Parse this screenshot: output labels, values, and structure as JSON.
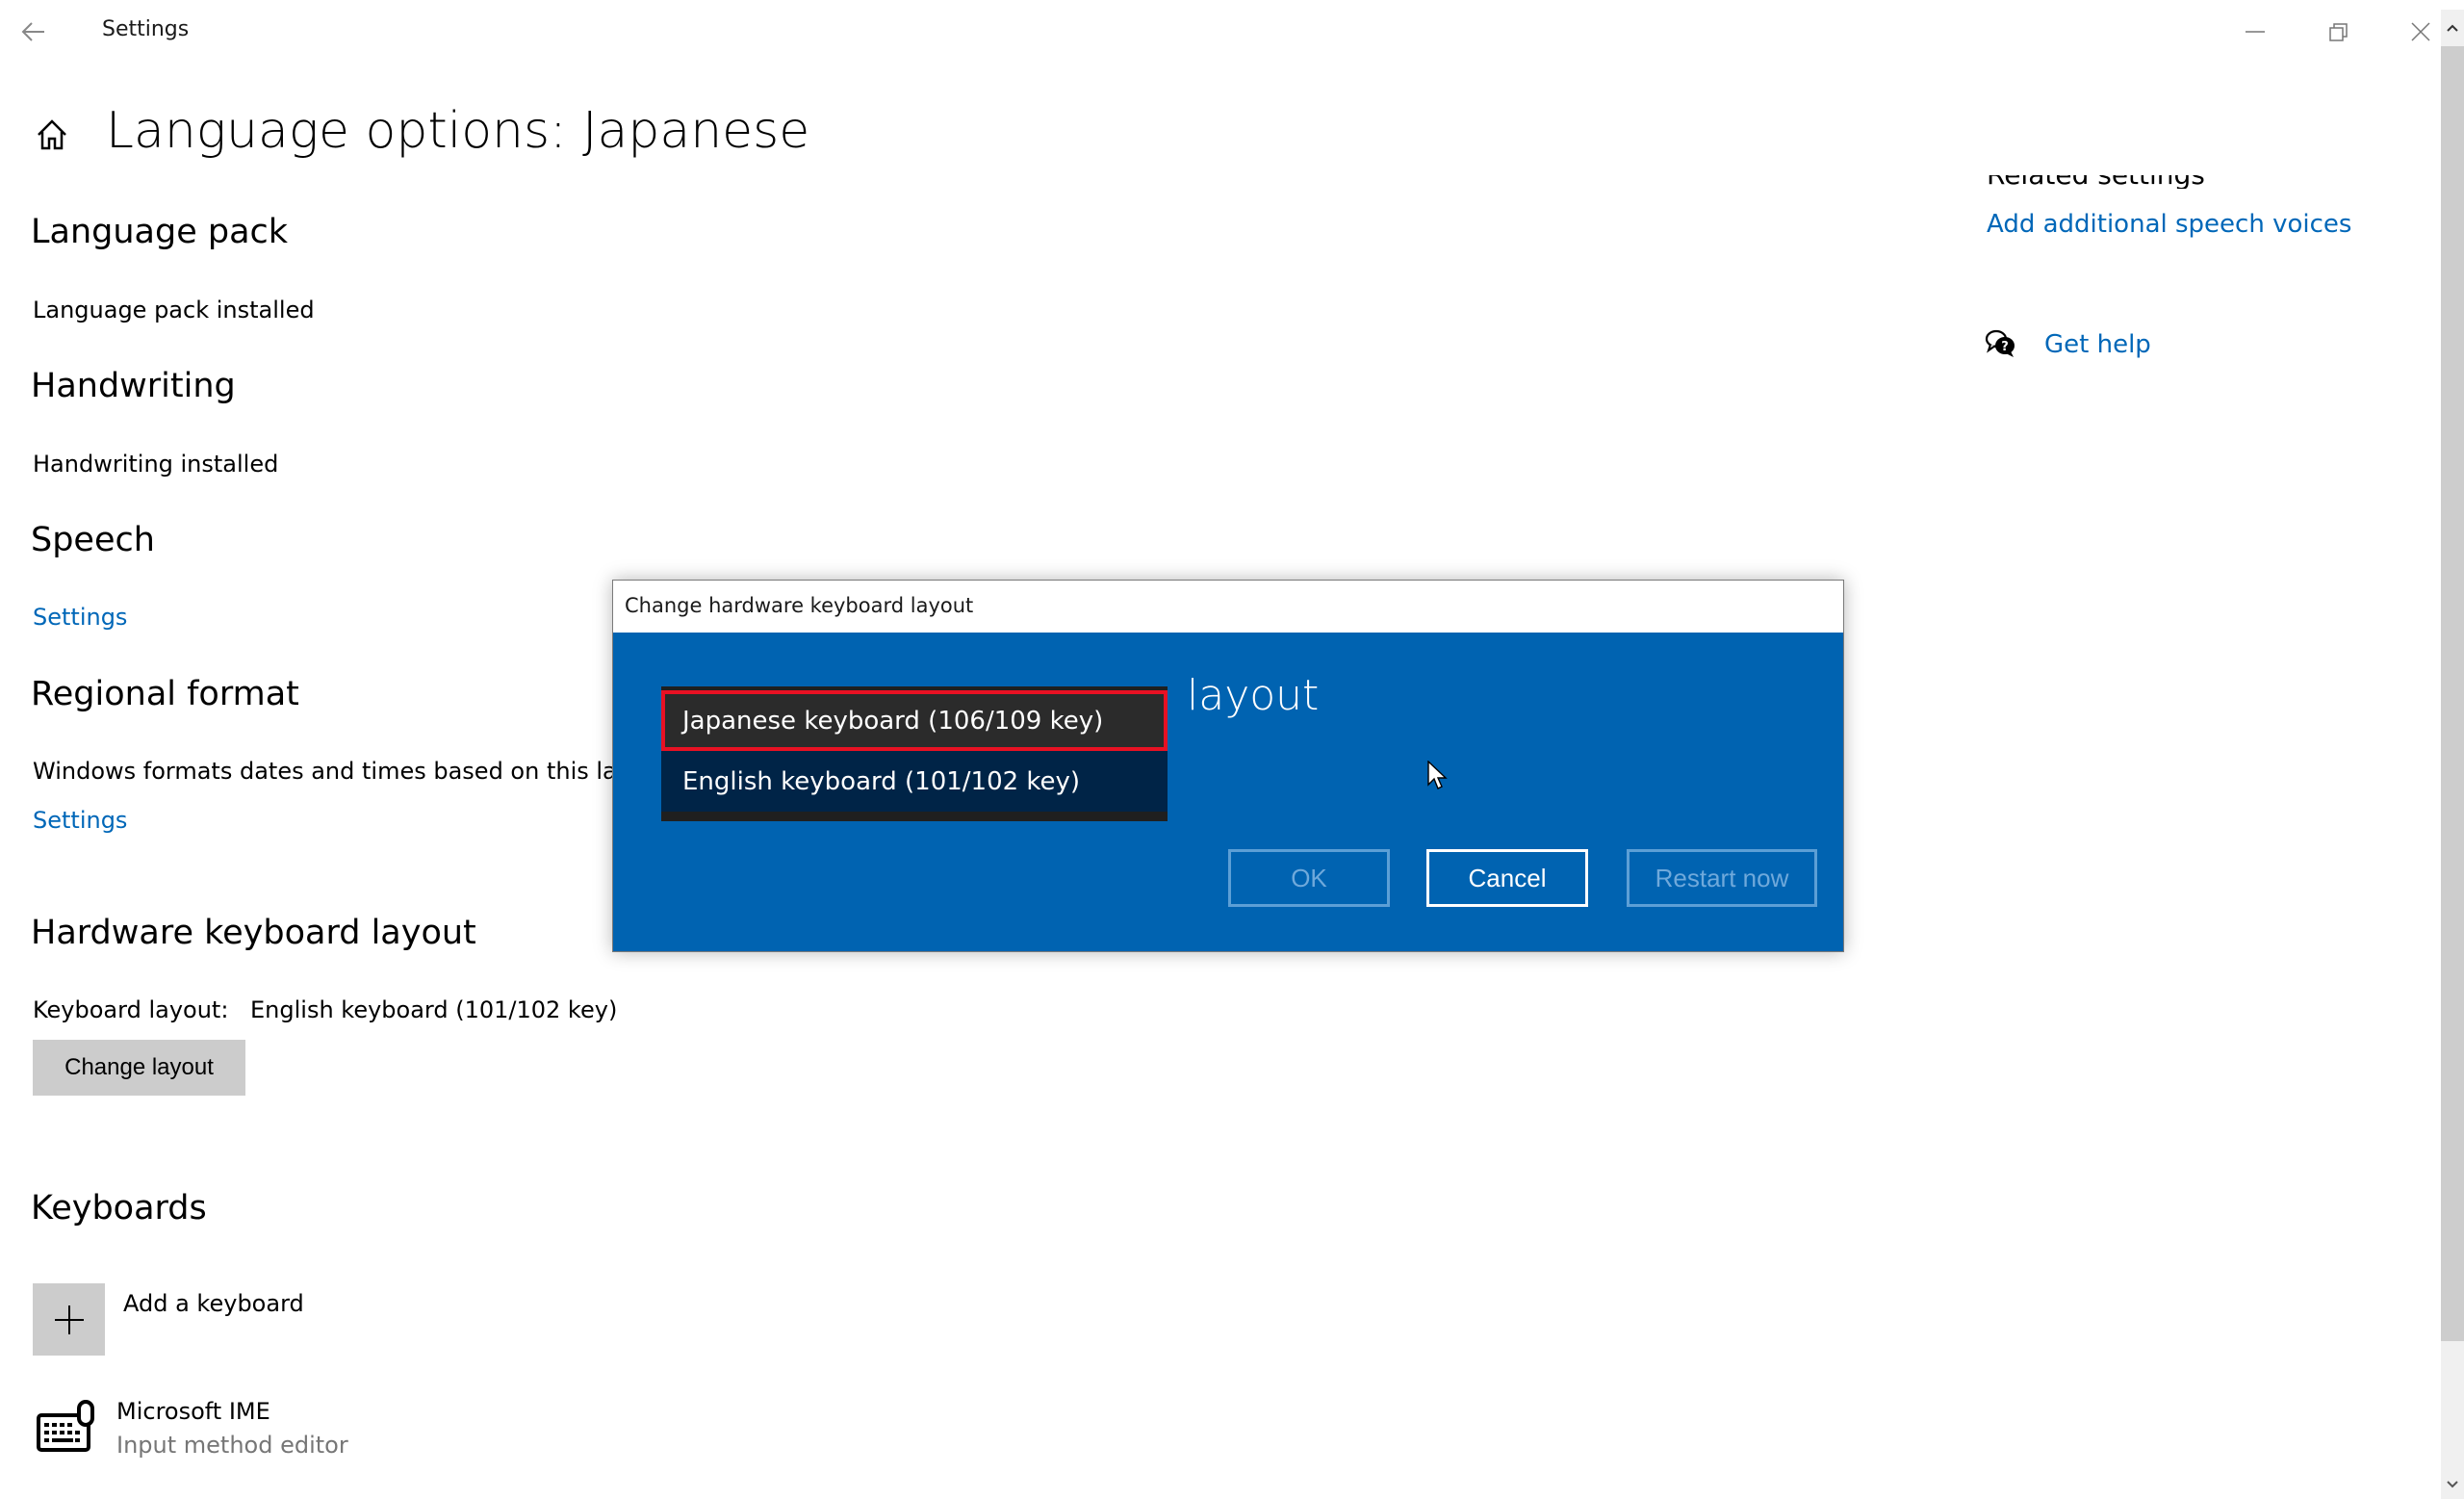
{
  "window": {
    "app_title": "Settings",
    "icons": {
      "back": "back-arrow-icon",
      "minimize": "minimize-icon",
      "maximize": "restore-icon",
      "close": "close-icon"
    }
  },
  "page": {
    "title": "Language options: Japanese",
    "home_icon": "home-icon"
  },
  "sections": {
    "language_pack": {
      "heading": "Language pack",
      "status": "Language pack installed"
    },
    "handwriting": {
      "heading": "Handwriting",
      "status": "Handwriting installed"
    },
    "speech": {
      "heading": "Speech",
      "link": "Settings"
    },
    "regional_format": {
      "heading": "Regional format",
      "description": "Windows formats dates and times based on this lan",
      "link": "Settings"
    },
    "hardware_keyboard": {
      "heading": "Hardware keyboard layout",
      "label": "Keyboard layout:",
      "value": "English keyboard (101/102 key)",
      "button": "Change layout"
    },
    "keyboards": {
      "heading": "Keyboards",
      "add_label": "Add a keyboard",
      "items": [
        {
          "name": "Microsoft IME",
          "subtitle": "Input method editor",
          "icon": "keyboard-icon"
        }
      ]
    }
  },
  "related": {
    "heading": "Related settings",
    "link": "Add additional speech voices",
    "help": "Get help"
  },
  "dialog": {
    "title": "Change hardware keyboard layout",
    "heading_visible": "layout",
    "dropdown": {
      "options": [
        {
          "label": "Japanese keyboard (106/109 key)",
          "highlighted": true
        },
        {
          "label": "English keyboard (101/102 key)",
          "highlighted": false
        }
      ]
    },
    "buttons": {
      "ok": "OK",
      "cancel": "Cancel",
      "restart": "Restart now"
    }
  },
  "colors": {
    "accent_link": "#0067b8",
    "dialog_bg": "#0063b1",
    "highlight_border": "#e81123"
  }
}
